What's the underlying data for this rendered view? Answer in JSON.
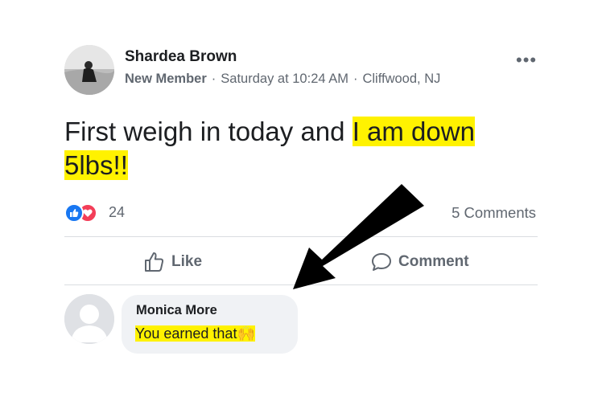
{
  "post": {
    "author": "Shardea Brown",
    "badge": "New Member",
    "time": "Saturday at 10:24 AM",
    "location": "Cliffwood, NJ",
    "text_plain": "First weigh in today and ",
    "text_highlight_1": "I am down",
    "text_highlight_2": "5lbs!!",
    "more_icon": "•••"
  },
  "reactions": {
    "count": "24",
    "icons": [
      "like-icon",
      "love-icon"
    ]
  },
  "comments_count": "5 Comments",
  "actions": {
    "like_label": "Like",
    "comment_label": "Comment"
  },
  "comment": {
    "author": "Monica More",
    "text": "You earned that",
    "emoji": "🙌"
  },
  "colors": {
    "highlight": "#fff200",
    "like_blue": "#1877f2",
    "love_red": "#f33e58",
    "text_secondary": "#606770",
    "bubble_bg": "#f0f2f5"
  }
}
